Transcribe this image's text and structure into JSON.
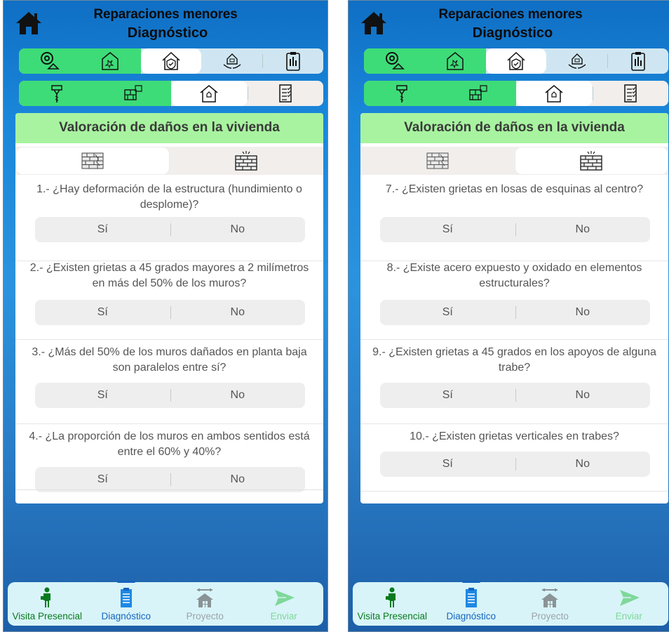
{
  "screens": [
    {
      "header": {
        "title": "Reparaciones menores",
        "subtitle": "Diagnóstico"
      },
      "section_title": "Valoración de daños en la vivienda",
      "questions": [
        {
          "text": "1.- ¿Hay deformación de la estructura (hundimiento o desplome)?",
          "yes": "Sí",
          "no": "No"
        },
        {
          "text": "2.- ¿Existen grietas a 45 grados mayores a 2 milímetros en más del 50% de los muros?",
          "yes": "Sí",
          "no": "No"
        },
        {
          "text": "3.- ¿Más del 50% de los muros dañados en planta baja son paralelos entre sí?",
          "yes": "Sí",
          "no": "No"
        },
        {
          "text": "4.- ¿La proporción de los muros en ambos sentidos está entre el 60% y 40%?",
          "yes": "Sí",
          "no": "No"
        }
      ],
      "active_subtab": "brick-wall"
    },
    {
      "header": {
        "title": "Reparaciones menores",
        "subtitle": "Diagnóstico"
      },
      "section_title": "Valoración de daños en la vivienda",
      "questions": [
        {
          "text": "7.- ¿Existen grietas en losas de esquinas al centro?",
          "yes": "Sí",
          "no": "No"
        },
        {
          "text": "8.- ¿Existe acero expuesto y oxidado en elementos estructurales?",
          "yes": "Sí",
          "no": "No"
        },
        {
          "text": "9.- ¿Existen grietas a 45 grados en los apoyos de alguna trabe?",
          "yes": "Sí",
          "no": "No"
        },
        {
          "text": "10.- ¿Existen grietas verticales en trabes?",
          "yes": "Sí",
          "no": "No"
        }
      ],
      "active_subtab": "damaged-wall"
    }
  ],
  "nav": [
    {
      "label": "Visita Presencial",
      "icon": "person-icon",
      "color": "#0a7a1e"
    },
    {
      "label": "Diagnóstico",
      "icon": "clipboard-icon",
      "color": "#1565c0",
      "active": true
    },
    {
      "label": "Proyecto",
      "icon": "house-tools-icon",
      "color": "#9aa3a8"
    },
    {
      "label": "Enviar",
      "icon": "send-icon",
      "color": "#7fd89a"
    }
  ],
  "colors": {
    "green_tab": "#3ddc78",
    "card_header": "#a8f3a0",
    "nav_bg": "#d8f4f8",
    "accent": "#1565c0"
  }
}
